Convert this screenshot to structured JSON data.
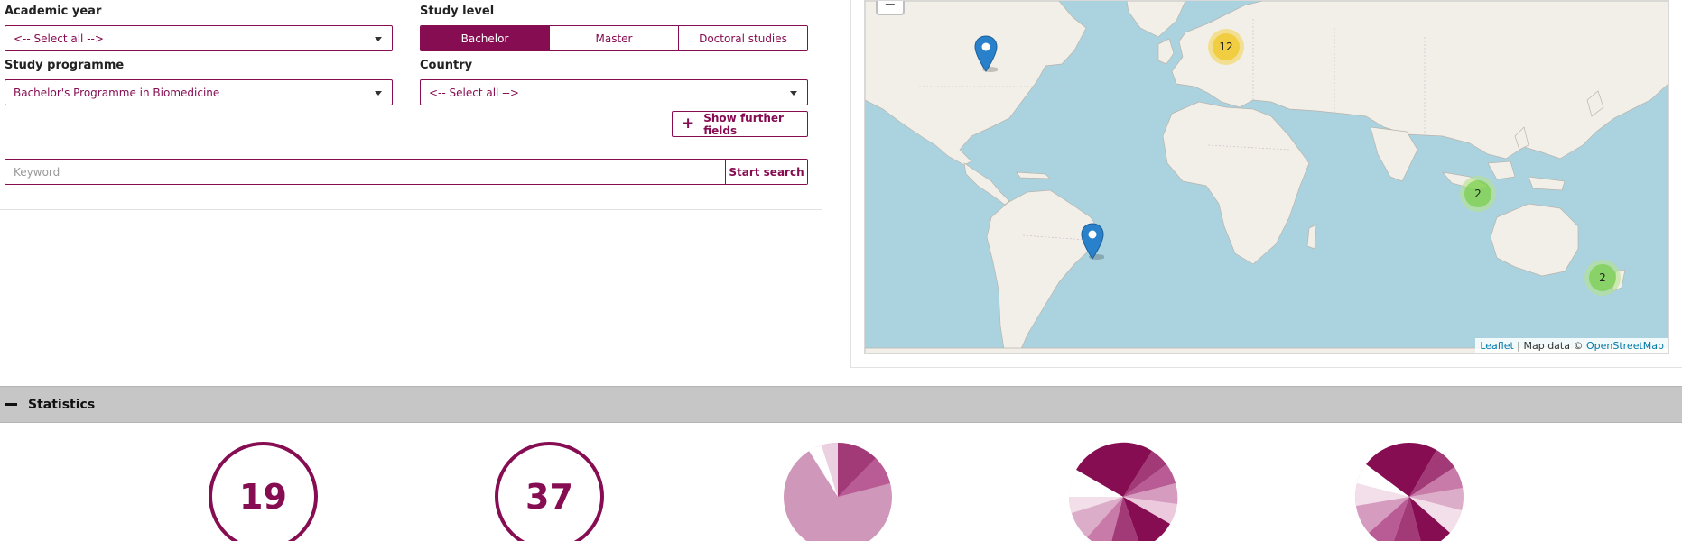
{
  "filters": {
    "academic_year": {
      "label": "Academic year",
      "value": "<-- Select all -->"
    },
    "study_level": {
      "label": "Study level",
      "options": [
        "Bachelor",
        "Master",
        "Doctoral studies"
      ],
      "selected": "Bachelor"
    },
    "study_programme": {
      "label": "Study programme",
      "value": "Bachelor's Programme in Biomedicine"
    },
    "country": {
      "label": "Country",
      "value": "<-- Select all -->"
    },
    "further_fields_button": "Show further fields",
    "keyword": {
      "placeholder": "Keyword",
      "value": ""
    },
    "search_button": "Start search"
  },
  "map": {
    "zoom_out_label": "−",
    "clusters": [
      {
        "count": "12",
        "color": "#f1d357"
      },
      {
        "count": "2",
        "color": "#a5d86e"
      },
      {
        "count": "2",
        "color": "#a5d86e"
      }
    ],
    "markers": 2,
    "attribution": {
      "leaflet": "Leaflet",
      "separator": " | Map data © ",
      "osm": "OpenStreetMap"
    }
  },
  "statistics": {
    "title": "Statistics",
    "values": [
      "19",
      "37"
    ]
  },
  "colors": {
    "accent": "#860d52",
    "water": "#aad3df",
    "land": "#f2efe9"
  }
}
